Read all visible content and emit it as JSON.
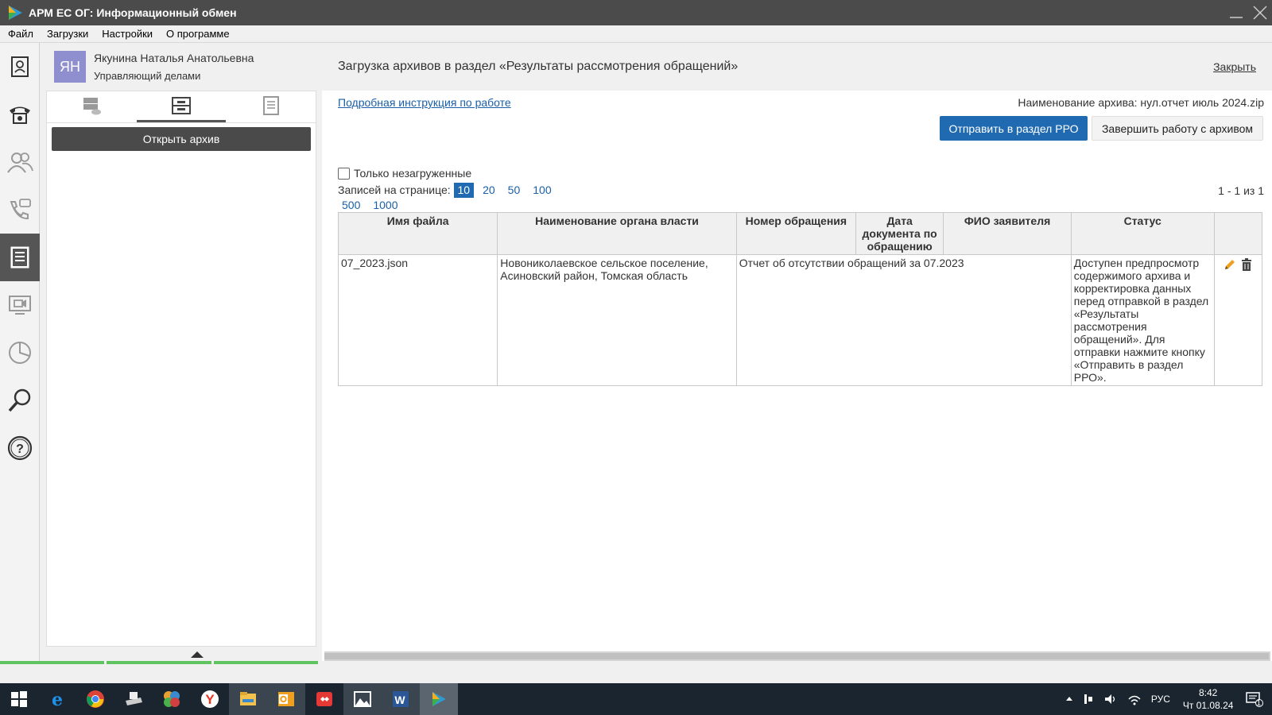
{
  "app": {
    "title": "АРМ ЕС ОГ: Информационный обмен"
  },
  "menu": [
    "Файл",
    "Загрузки",
    "Настройки",
    "О программе"
  ],
  "rail": {
    "items": [
      {
        "icon": "contact-card-icon"
      },
      {
        "icon": "phone-icon"
      },
      {
        "icon": "users-icon"
      },
      {
        "icon": "phone-chat-icon"
      },
      {
        "icon": "document-icon"
      },
      {
        "icon": "video-chat-icon"
      },
      {
        "icon": "pie-chart-icon"
      },
      {
        "icon": "magnifier-icon"
      },
      {
        "icon": "help-icon"
      }
    ],
    "active_index": 4
  },
  "user": {
    "initials": "ЯН",
    "name": "Якунина Наталья Анатольевна",
    "role": "Управляющий делами"
  },
  "leftpanel": {
    "open_archive": "Открыть архив"
  },
  "main": {
    "title": "Загрузка архивов в раздел «Результаты рассмотрения обращений»",
    "close": "Закрыть",
    "instruction_link": "Подробная инструкция по работе",
    "archive_name": "Наименование архива: нул.отчет июль 2024.zip",
    "send_button": "Отправить в раздел РРО",
    "finish_button": "Завершить работу с архивом",
    "only_unloaded": "Только незагруженные",
    "per_page_label": "Записей на странице:",
    "per_page_options": [
      "10",
      "20",
      "50",
      "100",
      "500",
      "1000"
    ],
    "per_page_selected": "10",
    "page_count": "1 - 1 из 1"
  },
  "table": {
    "headers": [
      "Имя файла",
      "Наименование органа власти",
      "Номер обращения",
      "Дата документа по обращению",
      "ФИО заявителя",
      "Статус",
      ""
    ],
    "rows": [
      {
        "file": "07_2023.json",
        "authority": "Новониколаевское сельское поселение, Асиновский район, Томская область",
        "number": "Отчет об отсутствии обращений за 07.2023",
        "date": "",
        "applicant": "",
        "status": "Доступен предпросмотр содержимого архива и корректировка данных перед отправкой в раздел «Результаты рассмотрения обращений». Для отправки нажмите кнопку «Отправить в раздел РРО»."
      }
    ]
  },
  "taskbar": {
    "apps": [
      "start-icon",
      "edge-icon",
      "chrome-icon",
      "scanner-icon",
      "puzzle-app-icon",
      "yandex-icon",
      "explorer-icon",
      "outlook-icon",
      "anydesk-icon",
      "photos-icon",
      "word-icon",
      "arm-app-icon"
    ],
    "language": "РУС",
    "time": "8:42",
    "date": "Чт 01.08.24",
    "notification_count": "1"
  },
  "colors": {
    "accent": "#1f6ab0",
    "titlebar": "#4b4b4b",
    "taskbar": "#1b2530",
    "progress": "#5fc45f"
  }
}
